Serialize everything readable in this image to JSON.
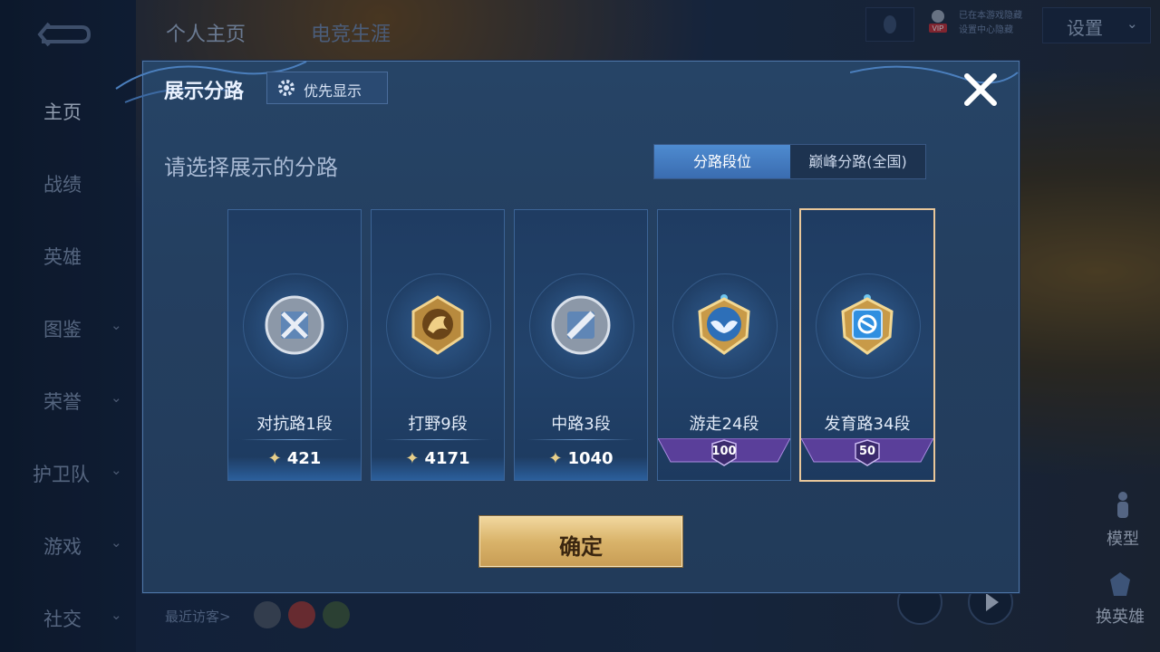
{
  "sidebar": {
    "items": [
      {
        "label": "主页",
        "active": true,
        "chevron": false
      },
      {
        "label": "战绩",
        "active": false,
        "chevron": false
      },
      {
        "label": "英雄",
        "active": false,
        "chevron": false
      },
      {
        "label": "图鉴",
        "active": false,
        "chevron": true
      },
      {
        "label": "荣誉",
        "active": false,
        "chevron": true
      },
      {
        "label": "护卫队",
        "active": false,
        "chevron": true
      },
      {
        "label": "游戏",
        "active": false,
        "chevron": true
      },
      {
        "label": "社交",
        "active": false,
        "chevron": true
      }
    ]
  },
  "header": {
    "tabs": [
      {
        "label": "个人主页"
      },
      {
        "label": "电竞生涯"
      }
    ],
    "vip_label": "VIP",
    "status_lines": [
      "已在本游戏隐藏",
      "设置中心隐藏"
    ],
    "settings_label": "设置"
  },
  "footer": {
    "visitors_label": "最近访客>",
    "model_label": "模型",
    "change_hero_label": "换英雄"
  },
  "dialog": {
    "title": "展示分路",
    "priority_label": "优先显示",
    "subtitle": "请选择展示的分路",
    "segments": [
      {
        "label": "分路段位",
        "active": true
      },
      {
        "label": "巅峰分路(全国)",
        "active": false
      }
    ],
    "cards": [
      {
        "name": "对抗路1段",
        "points": "421",
        "icon": "silver-crossed-swords-emblem",
        "selected": false
      },
      {
        "name": "打野9段",
        "points": "4171",
        "icon": "gold-dragon-emblem",
        "selected": false
      },
      {
        "name": "中路3段",
        "points": "1040",
        "icon": "silver-slash-emblem",
        "selected": false
      },
      {
        "name": "游走24段",
        "rank": "100",
        "icon": "gold-wings-emblem",
        "selected": false
      },
      {
        "name": "发育路34段",
        "rank": "50",
        "icon": "gold-blue-emblem",
        "selected": true
      }
    ],
    "confirm_label": "确定"
  },
  "colors": {
    "accent_blue": "#3a6cb0",
    "gold": "#d9b36a",
    "selected_border": "#e9c79a",
    "panel": "#243f60"
  }
}
